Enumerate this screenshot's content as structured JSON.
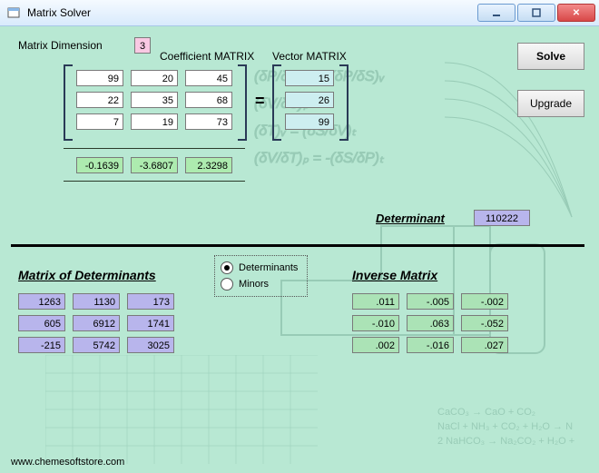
{
  "window": {
    "title": "Matrix Solver"
  },
  "labels": {
    "dimension": "Matrix Dimension",
    "coeff": "Coefficient MATRIX",
    "vector": "Vector MATRIX",
    "determinant": "Determinant",
    "matDet": "Matrix of Determinants",
    "inverse": "Inverse Matrix"
  },
  "dimension": "3",
  "coeff": {
    "r1": {
      "c1": "99",
      "c2": "20",
      "c3": "45"
    },
    "r2": {
      "c1": "22",
      "c2": "35",
      "c3": "68"
    },
    "r3": {
      "c1": "7",
      "c2": "19",
      "c3": "73"
    }
  },
  "vector": {
    "r1": "15",
    "r2": "26",
    "r3": "99"
  },
  "solution": {
    "x1": "-0.1639",
    "x2": "-3.6807",
    "x3": "2.3298"
  },
  "determinant_value": "110222",
  "buttons": {
    "solve": "Solve",
    "upgrade": "Upgrade"
  },
  "radio": {
    "determinants": "Determinants",
    "minors": "Minors",
    "selected": "determinants"
  },
  "detMatrix": {
    "r1": {
      "c1": "1263",
      "c2": "1130",
      "c3": "173"
    },
    "r2": {
      "c1": "605",
      "c2": "6912",
      "c3": "1741"
    },
    "r3": {
      "c1": "-215",
      "c2": "5742",
      "c3": "3025"
    }
  },
  "inverse": {
    "r1": {
      "c1": ".011",
      "c2": "-.005",
      "c3": "-.002"
    },
    "r2": {
      "c1": "-.010",
      "c2": ".063",
      "c3": "-.052"
    },
    "r3": {
      "c1": ".002",
      "c2": "-.016",
      "c3": ".027"
    }
  },
  "footer": "www.chemesoftstore.com",
  "equals": "="
}
